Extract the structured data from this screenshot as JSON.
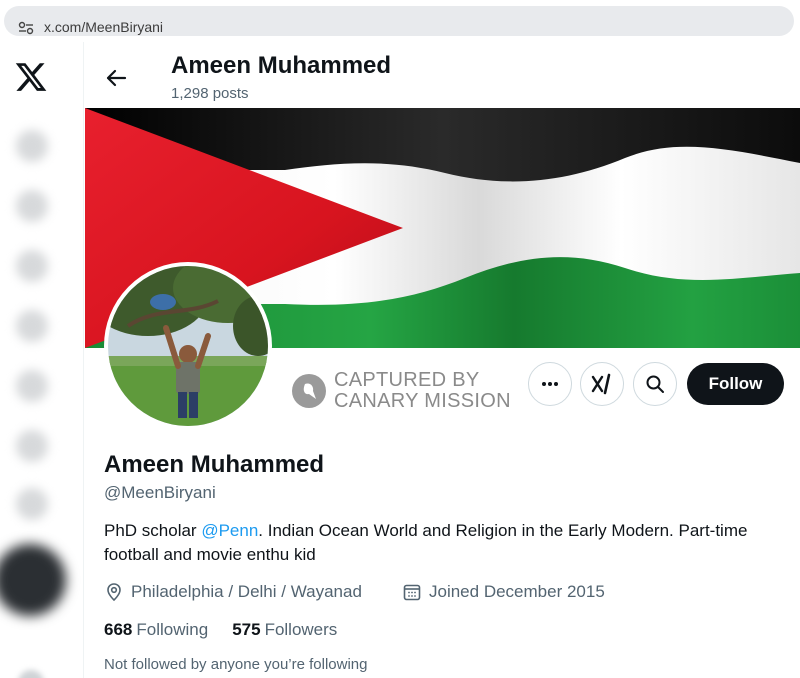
{
  "browser": {
    "url": "x.com/MeenBiryani"
  },
  "header": {
    "name": "Ameen Muhammed",
    "post_count": "1,298 posts"
  },
  "watermark": {
    "line1": "CAPTURED BY",
    "line2": "CANARY MISSION"
  },
  "actions": {
    "follow_label": "Follow",
    "more_icon": "more-horizontal-icon",
    "grok_icon": "grok-icon",
    "search_icon": "search-icon"
  },
  "profile": {
    "name": "Ameen Muhammed",
    "handle": "@MeenBiryani",
    "bio_before": "PhD scholar ",
    "bio_mention": "@Penn",
    "bio_after": ". Indian Ocean World and Religion in the Early Modern. Part-time football and movie enthu kid",
    "location": "Philadelphia / Delhi / Wayanad",
    "joined": "Joined December 2015",
    "following_count": "668",
    "following_label": "Following",
    "followers_count": "575",
    "followers_label": "Followers",
    "not_followed": "Not followed by anyone you’re following"
  },
  "colors": {
    "accent": "#1d9bf0",
    "text": "#0f1419",
    "secondary": "#536471",
    "flag_red": "#e41d2b",
    "flag_green": "#1d9b3b",
    "flag_black": "#111111"
  }
}
